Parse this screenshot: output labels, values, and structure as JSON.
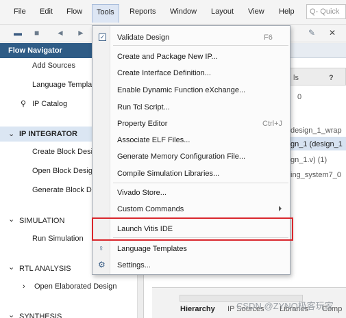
{
  "menubar": {
    "items": [
      "File",
      "Edit",
      "Flow",
      "Tools",
      "Reports",
      "Window",
      "Layout",
      "View",
      "Help"
    ],
    "quick_access": "Q- Quick"
  },
  "flow_navigator": {
    "title": "Flow Navigator",
    "items": {
      "add_sources": "Add Sources",
      "language_templates": "Language Templa",
      "ip_catalog": "IP Catalog",
      "ip_integrator": "IP INTEGRATOR",
      "create_block_design": "Create Block Desi",
      "open_block_design": "Open Block Desig",
      "generate_block_design": "Generate Block D",
      "simulation": "SIMULATION",
      "run_simulation": "Run Simulation",
      "rtl_analysis": "RTL ANALYSIS",
      "open_elaborated_design": "Open Elaborated Design",
      "synthesis": "SYNTHESIS"
    }
  },
  "right_panel": {
    "tab_fragment": "ls",
    "help_mark": "?",
    "count": "0",
    "rows": [
      "design_1_wrap",
      "gn_1 (design_1",
      "gn_1.v) (1)",
      "ing_system7_0"
    ],
    "bottom_tabs": [
      "Hierarchy",
      "IP Sources",
      "Libraries",
      "Comp"
    ]
  },
  "tools_menu": {
    "validate": {
      "label": "Validate Design",
      "accel": "F6"
    },
    "create_package_ip": "Create and Package New IP...",
    "create_interface": "Create Interface Definition...",
    "dfx": "Enable Dynamic Function eXchange...",
    "run_tcl": "Run Tcl Script...",
    "property_editor": {
      "label": "Property Editor",
      "accel": "Ctrl+J"
    },
    "associate_elf": "Associate ELF Files...",
    "memory_config": "Generate Memory Configuration File...",
    "compile_sim_libs": "Compile Simulation Libraries...",
    "vivado_store": "Vivado Store...",
    "custom_commands": "Custom Commands",
    "launch_vitis": "Launch Vitis IDE",
    "language_templates": "Language Templates",
    "settings": "Settings..."
  },
  "watermark": "CSDN @ZYNQ极客玩家",
  "colors": {
    "nav_header": "#2f5c86",
    "highlight_box": "#d9262c",
    "menu_active": "#dde6f4"
  }
}
